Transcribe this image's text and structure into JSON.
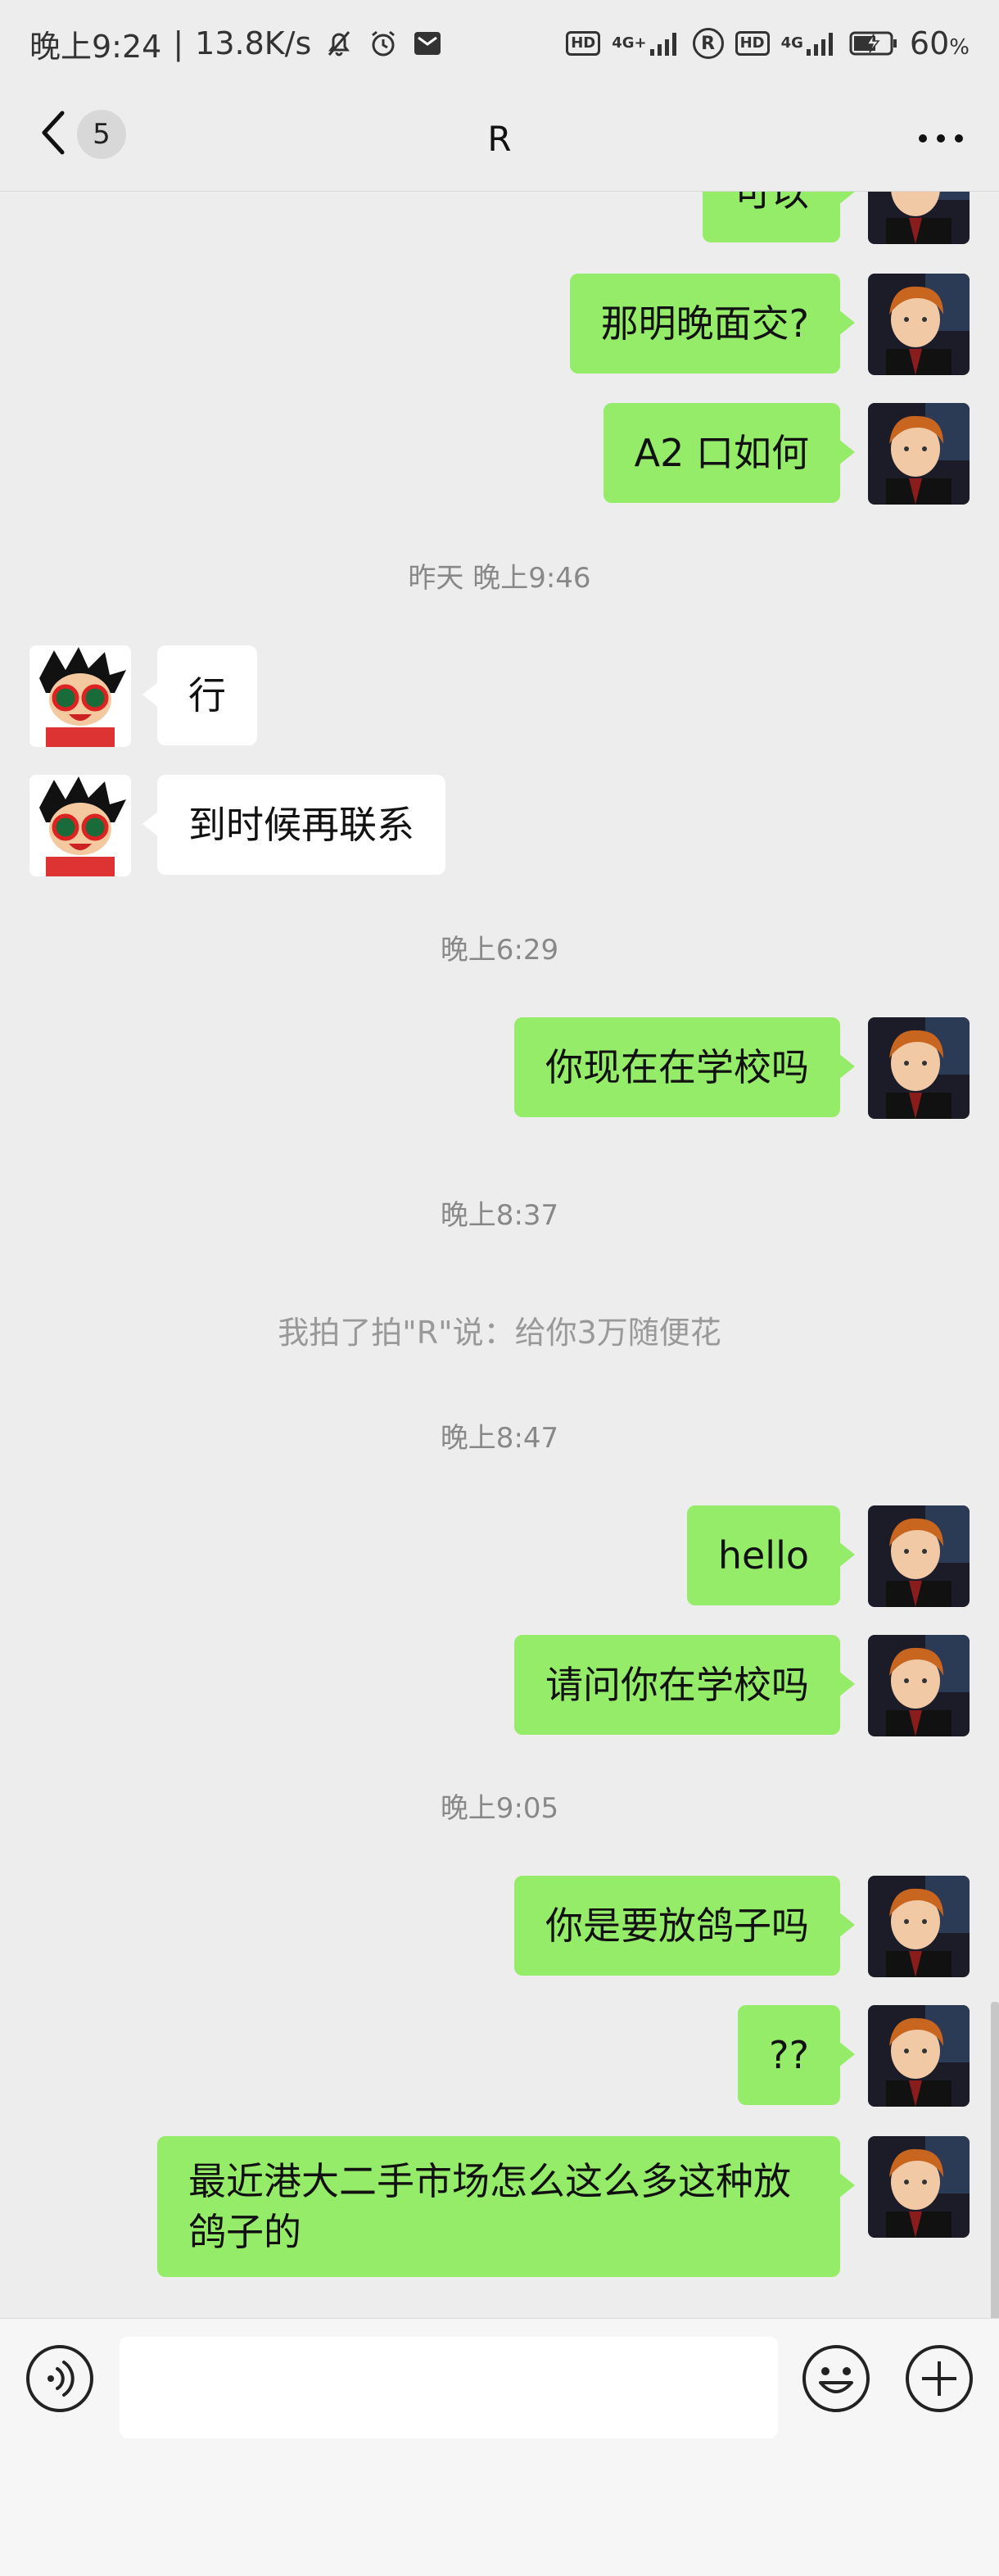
{
  "status_bar": {
    "time": "晚上9:24",
    "separator": "|",
    "net_speed": "13.8K/s",
    "hd1": "HD",
    "net1": "4G+",
    "r_label": "R",
    "hd2": "HD",
    "net2": "4G",
    "battery": "60",
    "battery_unit": "%"
  },
  "header": {
    "unread_count": "5",
    "title": "R"
  },
  "messages": [
    {
      "type": "me",
      "text": "可以"
    },
    {
      "type": "me",
      "text": "那明晚面交?"
    },
    {
      "type": "me",
      "text": "A2 口如何"
    },
    {
      "type": "time",
      "text": "昨天 晚上9:46"
    },
    {
      "type": "other",
      "text": "行"
    },
    {
      "type": "other",
      "text": "到时候再联系"
    },
    {
      "type": "time",
      "text": "晚上6:29"
    },
    {
      "type": "me",
      "text": "你现在在学校吗"
    },
    {
      "type": "time",
      "text": "晚上8:37"
    },
    {
      "type": "system",
      "text": "我拍了拍\"R\"说：给你3万随便花"
    },
    {
      "type": "time",
      "text": "晚上8:47"
    },
    {
      "type": "me",
      "text": "hello"
    },
    {
      "type": "me",
      "text": "请问你在学校吗"
    },
    {
      "type": "time",
      "text": "晚上9:05"
    },
    {
      "type": "me",
      "text": "你是要放鸽子吗"
    },
    {
      "type": "me",
      "text": "??"
    },
    {
      "type": "me",
      "text": "最近港大二手市场怎么这么多这种放鸽子的"
    }
  ],
  "input_bar": {
    "placeholder": ""
  },
  "icons": {
    "back": "back-chevron-icon",
    "more": "more-dots-icon",
    "voice": "voice-icon",
    "emoji": "emoji-icon",
    "plus": "plus-icon"
  },
  "colors": {
    "my_bubble": "#95ec69",
    "their_bubble": "#ffffff",
    "background": "#ededed"
  }
}
